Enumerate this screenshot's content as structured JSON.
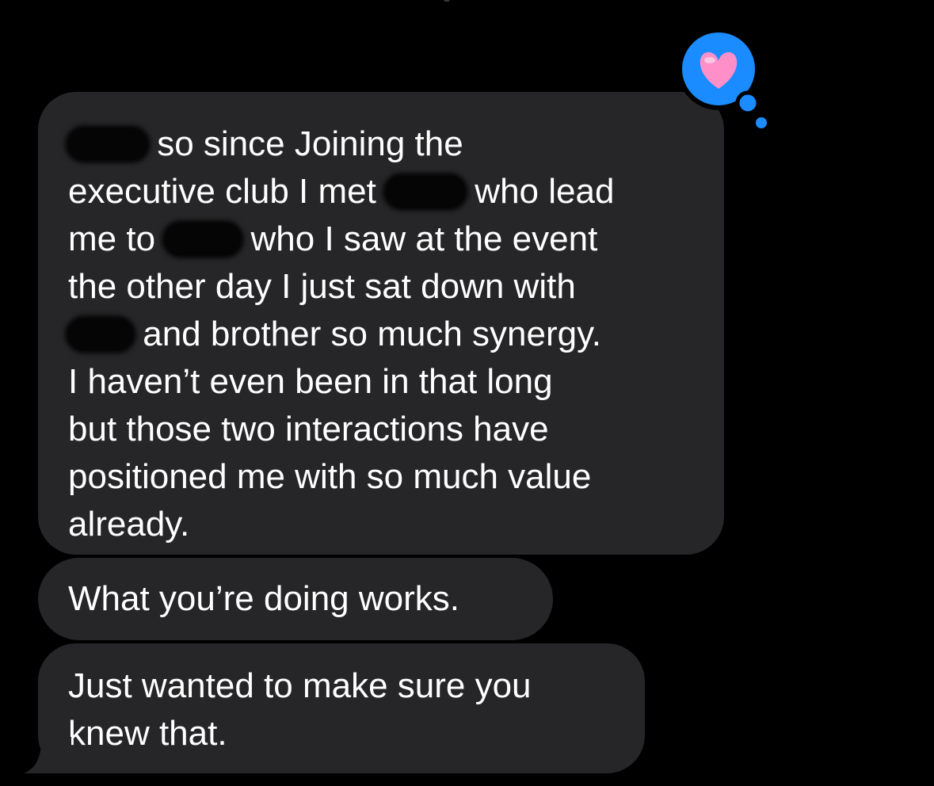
{
  "conversation": {
    "messages": [
      {
        "sender": "contact",
        "lines": [
          {
            "parts": [
              {
                "redacted": true
              },
              {
                "text": " so since Joining the"
              }
            ]
          },
          {
            "parts": [
              {
                "text": "executive club I met "
              },
              {
                "redacted": true
              },
              {
                "text": " who lead"
              }
            ]
          },
          {
            "parts": [
              {
                "text": "me to "
              },
              {
                "redacted": true
              },
              {
                "text": " who I saw at the event"
              }
            ]
          },
          {
            "parts": [
              {
                "text": "the other day I just sat down with"
              }
            ]
          },
          {
            "parts": [
              {
                "redacted": true
              },
              {
                "text": " and brother so much synergy."
              }
            ]
          },
          {
            "parts": [
              {
                "text": "I haven’t even been in that long"
              }
            ]
          },
          {
            "parts": [
              {
                "text": "but those two interactions have"
              }
            ]
          },
          {
            "parts": [
              {
                "text": "positioned me with so much value"
              }
            ]
          },
          {
            "parts": [
              {
                "text": "already."
              }
            ]
          }
        ]
      },
      {
        "sender": "contact",
        "text": "What you’re doing works."
      },
      {
        "sender": "contact",
        "lines": [
          {
            "parts": [
              {
                "text": "Just wanted to make sure you"
              }
            ]
          },
          {
            "parts": [
              {
                "text": "knew that."
              }
            ]
          }
        ]
      }
    ],
    "tapback": {
      "icon": "heart-icon",
      "color": "#1a8cff",
      "heart_color": "#ff8fc8"
    },
    "colors": {
      "background": "#000000",
      "incoming_bubble": "#262628",
      "text": "#ffffff"
    }
  }
}
